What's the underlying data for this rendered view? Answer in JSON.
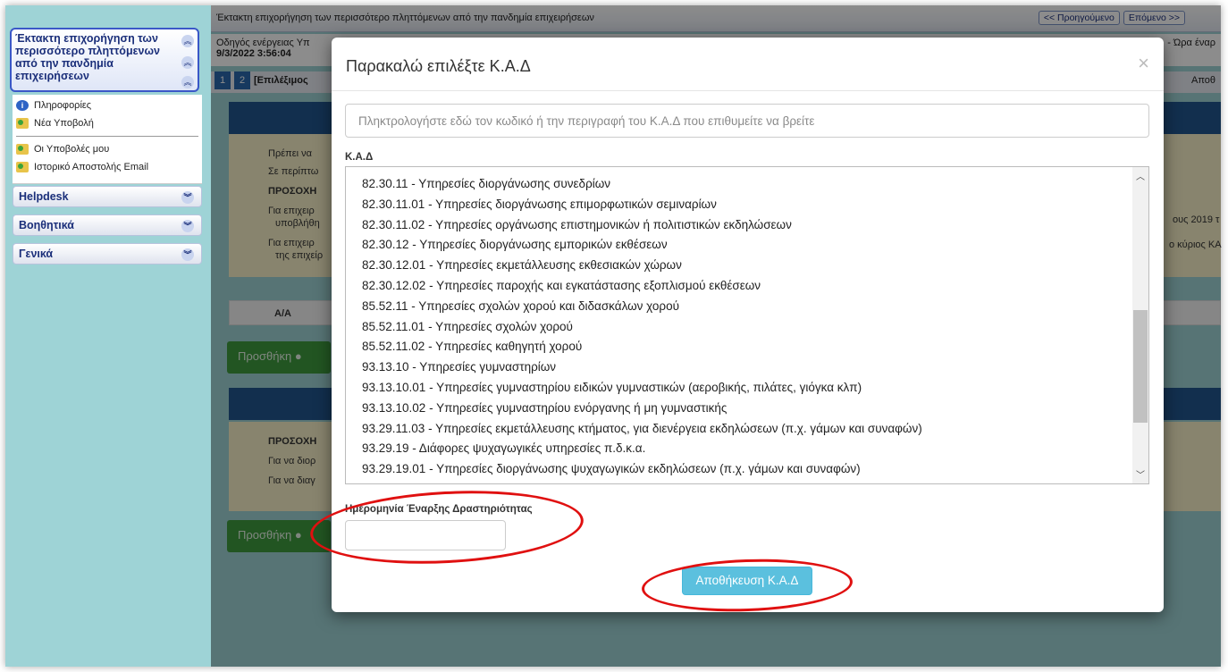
{
  "sidebar": {
    "panel_title": "Έκτακτη επιχορήγηση των περισσότερο πληττόμενων από την πανδημία επιχειρήσεων",
    "links": [
      {
        "label": "Πληροφορίες",
        "icon": "info-icon"
      },
      {
        "label": "Νέα Υποβολή",
        "icon": "folder-icon"
      },
      {
        "label": "Οι Υποβολές μου",
        "icon": "folder-icon"
      },
      {
        "label": "Ιστορικό Αποστολής Email",
        "icon": "folder-icon"
      }
    ],
    "categories": [
      "Helpdesk",
      "Βοηθητικά",
      "Γενικά"
    ]
  },
  "topbar": {
    "title": "Έκτακτη επιχορήγηση των περισσότερο πληττόμενων από την πανδημία επιχειρήσεων",
    "prev": "<< Προηγούμενο",
    "next": "Επόμενο >>"
  },
  "infobar": {
    "guide": "Οδηγός ενέργειας Υπ",
    "datetime": "9/3/2022 3:56:04",
    "right": "- Ώρα έναρ"
  },
  "steps": {
    "s1": "1",
    "s2": "2",
    "label": "[Επιλέξιμος"
  },
  "background": {
    "bullets1": [
      "Πρέπει να",
      "Σε περίπτω",
      "ΠΡΟΣΟΧΗ",
      "Για επιχειρ",
      "υποβλήθη",
      "Για επιχειρ",
      "της επιχείρ"
    ],
    "right_text1": "ους 2019 τ",
    "right_text2": "ο κύριος ΚΑ",
    "table_header": "Α/Α",
    "add_button": "Προσθήκη",
    "bullets2": [
      "ΠΡΟΣΟΧΗ",
      "Για να διορ",
      "Για να διαγ"
    ],
    "save_top": "Αποθ"
  },
  "modal": {
    "title": "Παρακαλώ επιλέξτε Κ.Α.Δ",
    "close": "×",
    "search_placeholder": "Πληκτρολογήστε εδώ τον κωδικό ή την περιγραφή του Κ.Α.Δ που επιθυμείτε να βρείτε",
    "kad_label": "Κ.Α.Δ",
    "items": [
      "82.30.11 - Υπηρεσίες διοργάνωσης συνεδρίων",
      "82.30.11.01 - Υπηρεσίες διοργάνωσης επιμορφωτικών σεμιναρίων",
      "82.30.11.02 - Υπηρεσίες οργάνωσης επιστημονικών ή πολιτιστικών εκδηλώσεων",
      "82.30.12 - Υπηρεσίες διοργάνωσης εμπορικών εκθέσεων",
      "82.30.12.01 - Υπηρεσίες εκμετάλλευσης εκθεσιακών χώρων",
      "82.30.12.02 - Υπηρεσίες παροχής και εγκατάστασης εξοπλισμού εκθέσεων",
      "85.52.11 - Υπηρεσίες σχολών χορού και διδασκάλων χορού",
      "85.52.11.01 - Υπηρεσίες σχολών χορού",
      "85.52.11.02 - Υπηρεσίες καθηγητή χορού",
      "93.13.10 - Υπηρεσίες γυμναστηρίων",
      "93.13.10.01 - Υπηρεσίες γυμναστηρίου ειδικών γυμναστικών (αεροβικής, πιλάτες, γιόγκα κλπ)",
      "93.13.10.02 - Υπηρεσίες γυμναστηρίου ενόργανης ή μη γυμναστικής",
      "93.29.11.03 - Υπηρεσίες εκμετάλλευσης κτήματος, για διενέργεια εκδηλώσεων (π.χ. γάμων και συναφών)",
      "93.29.19 - Διάφορες ψυχαγωγικές υπηρεσίες π.δ.κ.α.",
      "93.29.19.01 - Υπηρεσίες διοργάνωσης ψυχαγωγικών εκδηλώσεων (π.χ. γάμων και συναφών)"
    ],
    "date_label": "Ημερομηνία Έναρξης Δραστηριότητας",
    "date_value": "",
    "save_label": "Αποθήκευση Κ.Α.Δ"
  },
  "colors": {
    "accent_blue": "#21568f",
    "button_info": "#5bc0de",
    "annotation_red": "#e01010",
    "sidebar_bg": "#9ed3d6"
  }
}
